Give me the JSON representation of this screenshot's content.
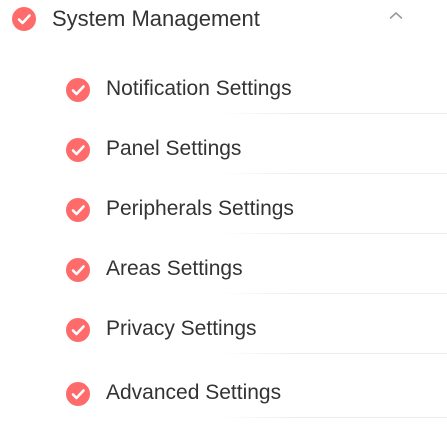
{
  "header": {
    "title": "System Management",
    "status_color": "#ff6a6a",
    "icon": "check-circle-icon",
    "collapse_icon": "chevron-up-icon"
  },
  "items": [
    {
      "label": "Notification Settings",
      "icon": "check-circle-icon"
    },
    {
      "label": "Panel Settings",
      "icon": "check-circle-icon"
    },
    {
      "label": "Peripherals Settings",
      "icon": "check-circle-icon"
    },
    {
      "label": "Areas Settings",
      "icon": "check-circle-icon"
    },
    {
      "label": "Privacy Settings",
      "icon": "check-circle-icon"
    },
    {
      "label": "Advanced Settings",
      "icon": "check-circle-icon"
    }
  ]
}
